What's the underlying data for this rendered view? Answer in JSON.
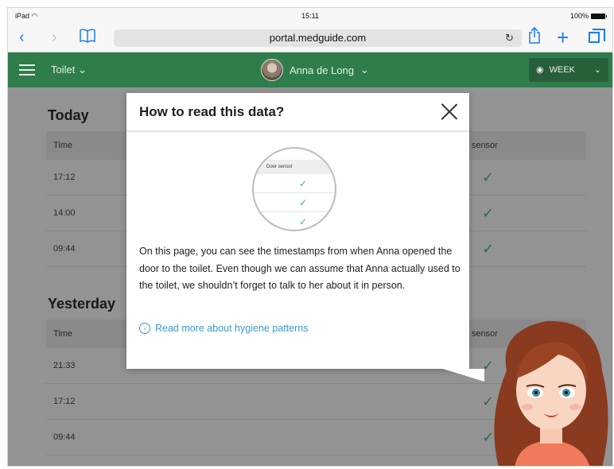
{
  "status_bar": {
    "device": "iPad",
    "time": "15:11",
    "battery": "100%"
  },
  "browser": {
    "url": "portal.medguide.com"
  },
  "app_header": {
    "section": "Toilet",
    "user_name": "Anna de Long",
    "period": "WEEK"
  },
  "content": {
    "today": {
      "title": "Today",
      "columns": {
        "time": "Time",
        "door": "Door sensor",
        "door_visible": "or sensor"
      },
      "rows": [
        {
          "time": "17:12"
        },
        {
          "time": "14:00"
        },
        {
          "time": "09:44"
        }
      ]
    },
    "yesterday": {
      "title": "Yesterday",
      "columns": {
        "time": "Time",
        "door_visible": "or sensor"
      },
      "rows": [
        {
          "time": "21:33"
        },
        {
          "time": "17:12"
        },
        {
          "time": "09:44"
        }
      ]
    }
  },
  "modal": {
    "title": "How to read this data?",
    "illustration_header": "Door sensor",
    "body": "On this page, you can see the timestamps from when Anna opened the door to the toilet. Even though we can assume that Anna actually used to the toilet, we shouldn’t forget to talk to her about it in person.",
    "link": "Read more about hygiene patterns"
  },
  "colors": {
    "app_green": "#2f7d4a",
    "check_green": "#47b36b",
    "link_blue": "#3a9bd5",
    "ios_blue": "#1a7cf0"
  },
  "icons": [
    "wifi-icon",
    "back-icon",
    "forward-icon",
    "bookmarks-icon",
    "reload-icon",
    "share-icon",
    "add-tab-icon",
    "tabs-icon",
    "hamburger-icon",
    "eye-icon",
    "check-icon",
    "close-icon",
    "chevron-right-circle-icon"
  ]
}
